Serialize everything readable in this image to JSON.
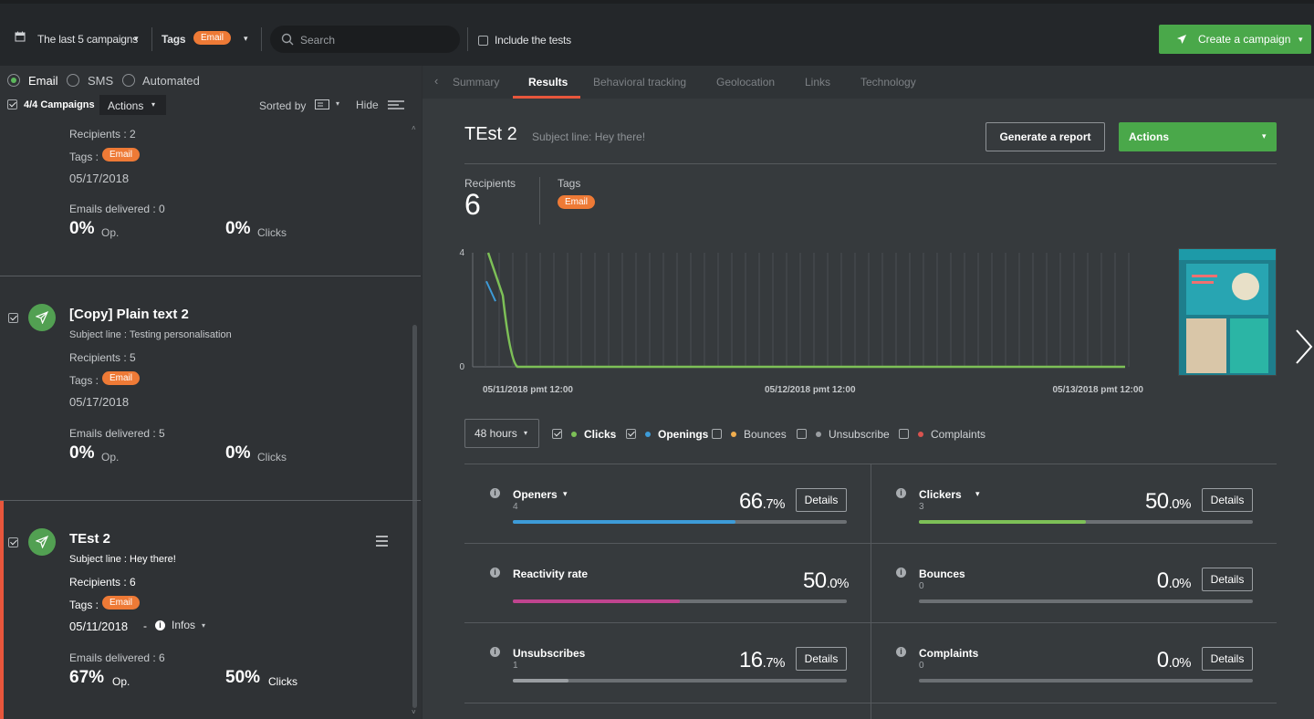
{
  "topbar": {
    "period": "The last 5 campaigns",
    "tags_label": "Tags",
    "tag_value": "Email",
    "search_placeholder": "Search",
    "include_tests": "Include the tests",
    "create_campaign": "Create a campaign"
  },
  "left": {
    "channels": [
      "Email",
      "SMS",
      "Automated"
    ],
    "selected_channel": "Email",
    "campaign_count": "4/4 Campaigns",
    "actions": "Actions",
    "sorted_by": "Sorted by",
    "hide": "Hide",
    "cards": [
      {
        "title": "",
        "subject": "",
        "recipients": "Recipients : 2",
        "tags_label": "Tags :",
        "tag": "Email",
        "date": "05/17/2018",
        "delivered": "Emails delivered : 0",
        "op_pct": "0%",
        "op_lbl": "Op.",
        "clicks_pct": "0%",
        "clicks_lbl": "Clicks"
      },
      {
        "title": "[Copy] Plain text 2",
        "subject": "Subject line : Testing personalisation",
        "recipients": "Recipients : 5",
        "tags_label": "Tags :",
        "tag": "Email",
        "date": "05/17/2018",
        "delivered": "Emails delivered : 5",
        "op_pct": "0%",
        "op_lbl": "Op.",
        "clicks_pct": "0%",
        "clicks_lbl": "Clicks"
      },
      {
        "title": "TEst 2",
        "subject": "Subject line : Hey there!",
        "recipients": "Recipients : 6",
        "tags_label": "Tags :",
        "tag": "Email",
        "date": "05/11/2018",
        "date_sep": "-",
        "infos": "Infos",
        "delivered": "Emails delivered : 6",
        "op_pct": "67%",
        "op_lbl": "Op.",
        "clicks_pct": "50%",
        "clicks_lbl": "Clicks"
      }
    ]
  },
  "tabs": [
    "Summary",
    "Results",
    "Behavioral tracking",
    "Geolocation",
    "Links",
    "Technology"
  ],
  "active_tab": "Results",
  "campaign": {
    "name": "TEst 2",
    "subject": "Subject line: Hey there!",
    "generate_report": "Generate a report",
    "actions": "Actions",
    "recipients_label": "Recipients",
    "recipients_value": "6",
    "tags_label": "Tags",
    "tag": "Email"
  },
  "chart_data": {
    "type": "line",
    "y_ticks": [
      "4",
      "0"
    ],
    "ylim": [
      0,
      4
    ],
    "x_ticks": [
      "05/11/2018 pmt 12:00",
      "05/12/2018 pmt 12:00",
      "05/13/2018 pmt 12:00"
    ],
    "series": [
      {
        "name": "Clicks",
        "color": "#7dc057",
        "values": [
          4,
          2.5,
          0,
          0,
          0
        ]
      },
      {
        "name": "Openings",
        "color": "#3d9bd8",
        "values": [
          3,
          2.3
        ]
      }
    ]
  },
  "filters": {
    "range": "48 hours",
    "items": [
      {
        "label": "Clicks",
        "checked": true,
        "color": "#7dc057"
      },
      {
        "label": "Openings",
        "checked": true,
        "color": "#3d9bd8"
      },
      {
        "label": "Bounces",
        "checked": false,
        "color": "#f0ad4e"
      },
      {
        "label": "Unsubscribe",
        "checked": false,
        "color": "#9a9ea2"
      },
      {
        "label": "Complaints",
        "checked": false,
        "color": "#d9534f"
      }
    ]
  },
  "stats": [
    {
      "title": "Openers",
      "sub": "4",
      "int": "66",
      "dec": ".7%",
      "fraction": 0.667,
      "color": "#3d9bd8",
      "details": "Details",
      "dropdown": true
    },
    {
      "title": "Clickers",
      "sub": "3",
      "int": "50",
      "dec": ".0%",
      "fraction": 0.5,
      "color": "#7dc057",
      "details": "Details",
      "dropdown": true
    },
    {
      "title": "Reactivity rate",
      "sub": "",
      "int": "50",
      "dec": ".0%",
      "fraction": 0.5,
      "color": "#c0448f",
      "details": "",
      "dropdown": false
    },
    {
      "title": "Bounces",
      "sub": "0",
      "int": "0",
      "dec": ".0%",
      "fraction": 0,
      "color": "#9a9ea2",
      "details": "Details",
      "dropdown": false
    },
    {
      "title": "Unsubscribes",
      "sub": "1",
      "int": "16",
      "dec": ".7%",
      "fraction": 0.167,
      "color": "#9a9ea2",
      "details": "Details",
      "dropdown": false
    },
    {
      "title": "Complaints",
      "sub": "0",
      "int": "0",
      "dec": ".0%",
      "fraction": 0,
      "color": "#9a9ea2",
      "details": "Details",
      "dropdown": false
    }
  ]
}
